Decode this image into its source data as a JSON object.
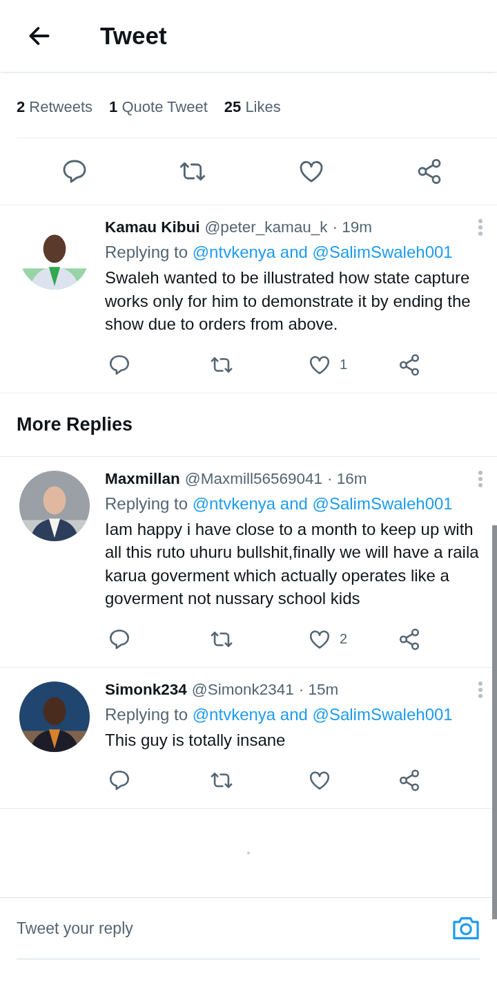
{
  "header": {
    "title": "Tweet"
  },
  "stats": [
    {
      "count": "2",
      "label": "Retweets"
    },
    {
      "count": "1",
      "label": "Quote Tweet"
    },
    {
      "count": "25",
      "label": "Likes"
    }
  ],
  "top_replies": [
    {
      "name": "Kamau Kibui",
      "handle": "@peter_kamau_k",
      "time": "· 19m",
      "replying_prefix": "Replying to",
      "mentions": "@ntvkenya and @SalimSwaleh001",
      "text": "Swaleh wanted to be illustrated how state capture works only for him to demonstrate it by ending the show due to orders from above.",
      "likes": "1"
    }
  ],
  "more_replies": {
    "heading": "More Replies",
    "replies": [
      {
        "name": "Maxmillan",
        "handle": "@Maxmill56569041",
        "time": "· 16m",
        "replying_prefix": "Replying to",
        "mentions": "@ntvkenya and @SalimSwaleh001",
        "text": "Iam happy i have close to a month to keep up with all this ruto uhuru bullshit,finally we will have a raila karua goverment which actually operates like a goverment not nussary school kids",
        "likes": "2"
      },
      {
        "name": "Simonk234",
        "handle": "@Simonk2341",
        "time": "· 15m",
        "replying_prefix": "Replying to",
        "mentions": "@ntvkenya and @SalimSwaleh001",
        "text": "This guy is totally insane"
      }
    ]
  },
  "reply_bar": {
    "placeholder": "Tweet your reply"
  }
}
